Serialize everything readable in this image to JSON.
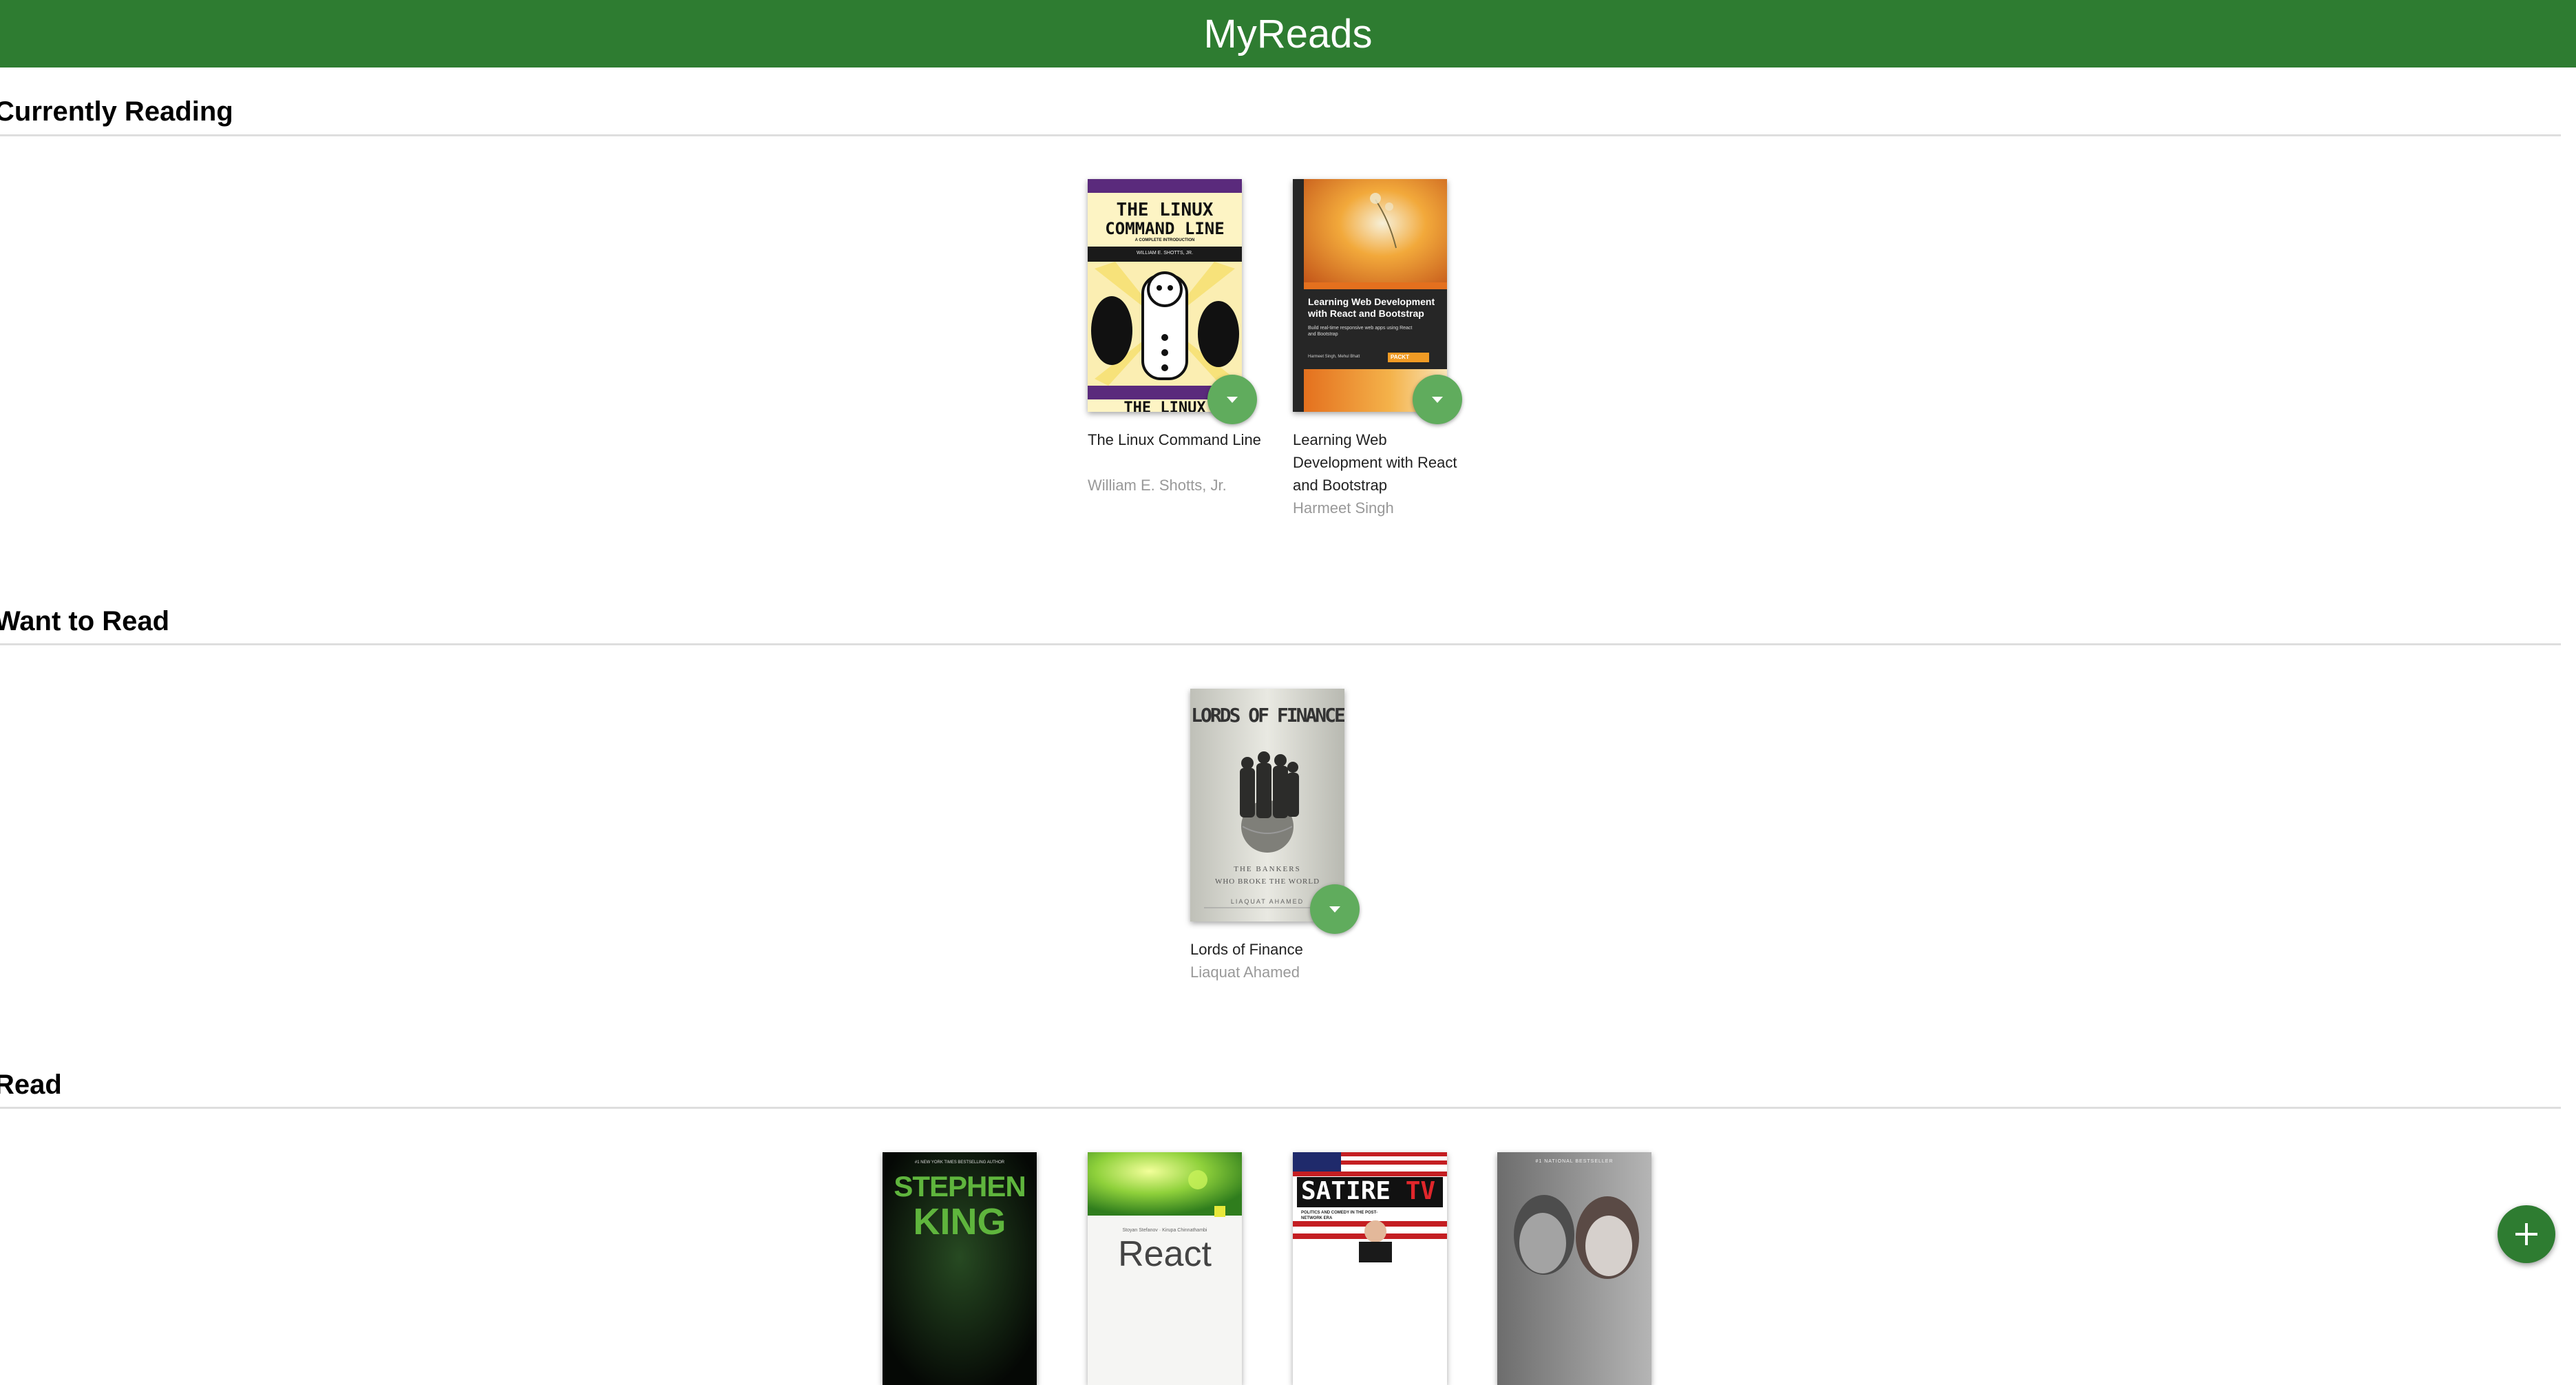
{
  "app": {
    "title": "MyReads"
  },
  "shelves": [
    {
      "title": "Currently Reading",
      "books": [
        {
          "title": "The Linux Command Line",
          "authors": "William E. Shotts, Jr.",
          "cover": {
            "line1": "THE LINUX",
            "line2": "COMMAND LINE",
            "subtitle": "A COMPLETE INTRODUCTION",
            "author": "WILLIAM E. SHOTTS, JR.",
            "footer": "THE LINUX"
          },
          "menu_icon": "chevron-down-icon"
        },
        {
          "title": "Learning Web Development with React and Bootstrap",
          "authors": "Harmeet Singh",
          "cover": {
            "title": "Learning Web Development with React and Bootstrap",
            "subtitle": "Build real-time responsive web apps using React and Bootstrap",
            "authors": "Harmeet Singh, Mehul Bhatt",
            "publisher": "PACKT"
          },
          "menu_icon": "chevron-down-icon"
        }
      ]
    },
    {
      "title": "Want to Read",
      "books": [
        {
          "title": "Lords of Finance",
          "authors": "Liaquat Ahamed",
          "cover": {
            "title": "LORDS OF FINANCE",
            "tag1": "THE BANKERS",
            "tag2": "WHO BROKE THE WORLD",
            "author": "LIAQUAT AHAMED"
          },
          "menu_icon": "chevron-down-icon"
        }
      ]
    },
    {
      "title": "Read",
      "books": [
        {
          "cover": {
            "top": "#1 NEW YORK TIMES BESTSELLING AUTHOR",
            "line1": "STEPHEN",
            "line2": "KING"
          }
        },
        {
          "cover": {
            "authors": "Stoyan Stefanov · Kirupa Chinnathambi",
            "title": "React"
          }
        },
        {
          "cover": {
            "title1": "SATIRE",
            "title2": "TV",
            "subtitle": "POLITICS AND COMEDY IN THE POST-NETWORK ERA"
          }
        },
        {
          "cover": {
            "top": "#1 NATIONAL BESTSELLER"
          }
        }
      ]
    }
  ],
  "fab": {
    "icon": "plus-icon"
  },
  "colors": {
    "header": "#2e7c31",
    "changer": "#60ac5d",
    "author_text": "#999999"
  }
}
